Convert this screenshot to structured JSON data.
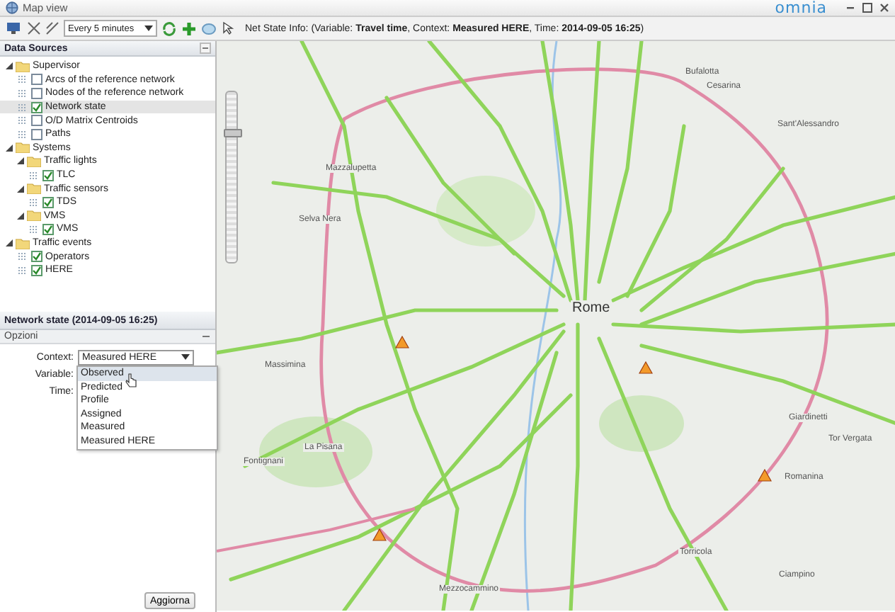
{
  "window": {
    "title": "Map view",
    "logo": "omnia"
  },
  "toolbar": {
    "refresh_select": {
      "value": "Every 5 minutes"
    },
    "info": "Net State Info: (Variable: **Travel time**, Context: **Measured HERE**, Time: **2014-09-05 16:25**)"
  },
  "data_sources": {
    "title": "Data Sources",
    "tree": [
      {
        "label": "Supervisor",
        "expanded": true,
        "selected": false,
        "children": [
          {
            "label": "Arcs of the reference network",
            "checked": false,
            "selected": false
          },
          {
            "label": "Nodes of the reference network",
            "checked": false,
            "selected": false
          },
          {
            "label": "Network state",
            "checked": true,
            "selected": true
          },
          {
            "label": "O/D Matrix Centroids",
            "checked": false,
            "selected": false
          },
          {
            "label": "Paths",
            "checked": false,
            "selected": false
          }
        ]
      },
      {
        "label": "Systems",
        "expanded": true,
        "selected": false,
        "children": [
          {
            "label": "Traffic lights",
            "expanded": true,
            "selected": false,
            "children": [
              {
                "label": "TLC",
                "checked": true,
                "selected": false
              }
            ]
          },
          {
            "label": "Traffic sensors",
            "expanded": true,
            "selected": false,
            "children": [
              {
                "label": "TDS",
                "checked": true,
                "selected": false
              }
            ]
          },
          {
            "label": "VMS",
            "expanded": true,
            "selected": false,
            "children": [
              {
                "label": "VMS",
                "checked": true,
                "selected": false
              }
            ]
          }
        ]
      },
      {
        "label": "Traffic events",
        "expanded": true,
        "selected": false,
        "children": [
          {
            "label": "Operators",
            "checked": true,
            "selected": false
          },
          {
            "label": "HERE",
            "checked": true,
            "selected": false
          }
        ]
      }
    ]
  },
  "network_state": {
    "title": "Network state (2014-09-05 16:25)",
    "section": "Opzioni",
    "fields": [
      {
        "label": "Context:",
        "value": "Measured HERE"
      },
      {
        "label": "Variable:"
      },
      {
        "label": "Time:"
      }
    ],
    "dropdown_options": [
      {
        "label": "Observed",
        "selected": true
      },
      {
        "label": "Predicted",
        "selected": false
      },
      {
        "label": "Profile",
        "selected": false
      },
      {
        "label": "Assigned",
        "selected": false
      },
      {
        "label": "Measured",
        "selected": false
      },
      {
        "label": "Measured HERE",
        "selected": false
      }
    ],
    "update_button": "Aggiorna"
  },
  "map": {
    "zoom": {
      "level": 0.75
    },
    "labels": [
      "Rome",
      "Ciampino",
      "Torricola",
      "Fontignani",
      "La Pisana",
      "Massimina",
      "Bufalotta",
      "Cesarina",
      "Sant'Alessandro",
      "Mazzalupetta",
      "Selva Nera",
      "Romanina",
      "Mezzocammino",
      "Tor Vergata",
      "Giardinetti"
    ]
  }
}
